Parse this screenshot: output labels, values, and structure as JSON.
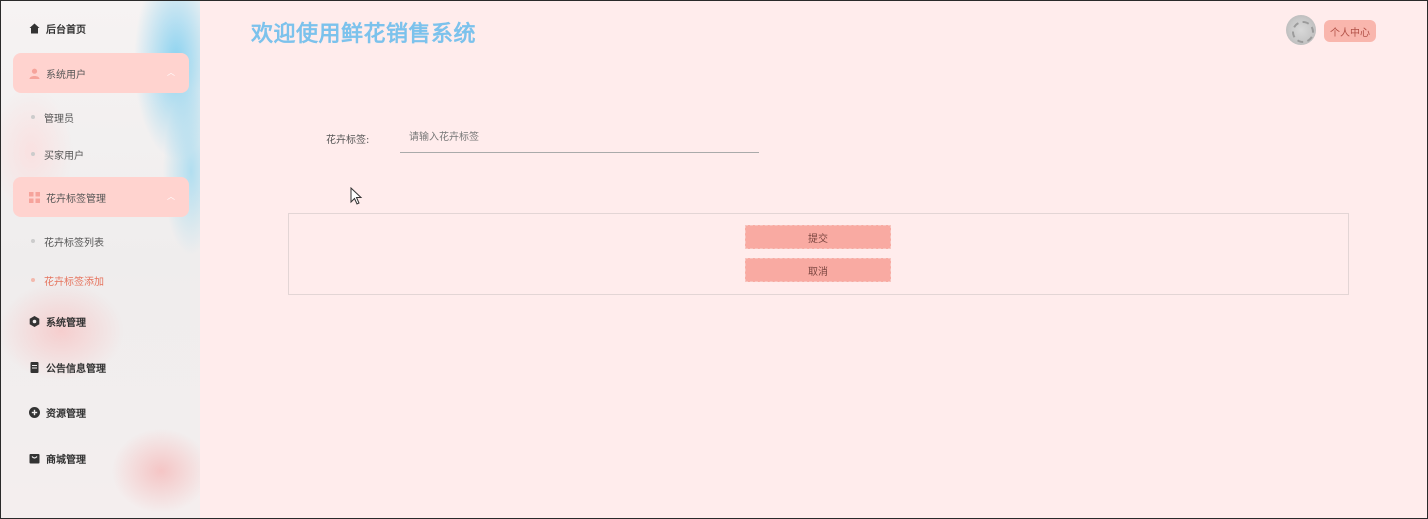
{
  "header": {
    "title": "欢迎使用鲜花销售系统",
    "personal_center": "个人中心"
  },
  "sidebar": {
    "items": [
      {
        "label": "后台首页",
        "icon": "home-icon"
      },
      {
        "label": "系统用户",
        "icon": "user-icon",
        "expanded": true,
        "children": [
          {
            "label": "管理员"
          },
          {
            "label": "买家用户"
          }
        ]
      },
      {
        "label": "花卉标签管理",
        "icon": "grid-icon",
        "expanded": true,
        "children": [
          {
            "label": "花卉标签列表"
          },
          {
            "label": "花卉标签添加",
            "active": true
          }
        ]
      },
      {
        "label": "系统管理",
        "icon": "gear-icon"
      },
      {
        "label": "公告信息管理",
        "icon": "document-icon"
      },
      {
        "label": "资源管理",
        "icon": "plus-circle-icon"
      },
      {
        "label": "商城管理",
        "icon": "shop-icon"
      }
    ]
  },
  "form": {
    "tag_label": "花卉标签:",
    "tag_placeholder": "请输入花卉标签",
    "tag_value": "",
    "submit_label": "提交",
    "cancel_label": "取消"
  },
  "colors": {
    "background": "#ffecec",
    "accent": "#f9aaa2",
    "title": "#7cc2ec",
    "active_text": "#e6735d"
  }
}
